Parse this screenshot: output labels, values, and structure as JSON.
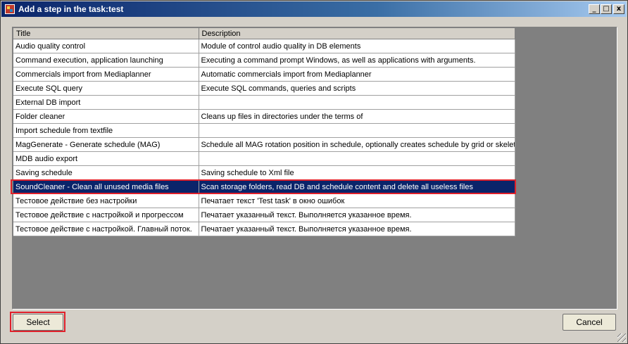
{
  "window": {
    "title": "Add a step in the task:test",
    "controls": {
      "minimize": "_",
      "maximize": "□",
      "close": "x"
    }
  },
  "table": {
    "columns": [
      "Title",
      "Description"
    ],
    "rows": [
      {
        "title": "Audio quality control",
        "description": "Module of control audio quality in DB elements"
      },
      {
        "title": "Command execution, application launching",
        "description": "Executing a command prompt Windows, as well as applications with arguments."
      },
      {
        "title": "Commercials import from Mediaplanner",
        "description": "Automatic commercials import from Mediaplanner"
      },
      {
        "title": "Execute SQL query",
        "description": "Execute SQL commands, queries and scripts"
      },
      {
        "title": "External DB import",
        "description": ""
      },
      {
        "title": "Folder cleaner",
        "description": "Cleans up files in directories under the terms of"
      },
      {
        "title": "Import schedule from textfile",
        "description": ""
      },
      {
        "title": "MagGenerate - Generate schedule (MAG)",
        "description": "Schedule all MAG rotation position in schedule, optionally creates schedule by grid or skeleton"
      },
      {
        "title": "MDB audio export",
        "description": ""
      },
      {
        "title": "Saving schedule",
        "description": "Saving schedule to Xml file"
      },
      {
        "title": "SoundCleaner - Clean all unused media files",
        "description": "Scan storage folders, read DB and schedule content and delete all useless files"
      },
      {
        "title": "Тестовое действие без настройки",
        "description": "Печатает текст 'Test task' в окно ошибок"
      },
      {
        "title": "Тестовое действие с настройкой и прогрессом",
        "description": "Печатает указанный текст. Выполняется указанное время."
      },
      {
        "title": "Тестовое действие с настройкой. Главный поток.",
        "description": "Печатает указанный текст. Выполняется указанное время."
      }
    ],
    "selected_index": 10
  },
  "buttons": {
    "select": "Select",
    "cancel": "Cancel"
  }
}
